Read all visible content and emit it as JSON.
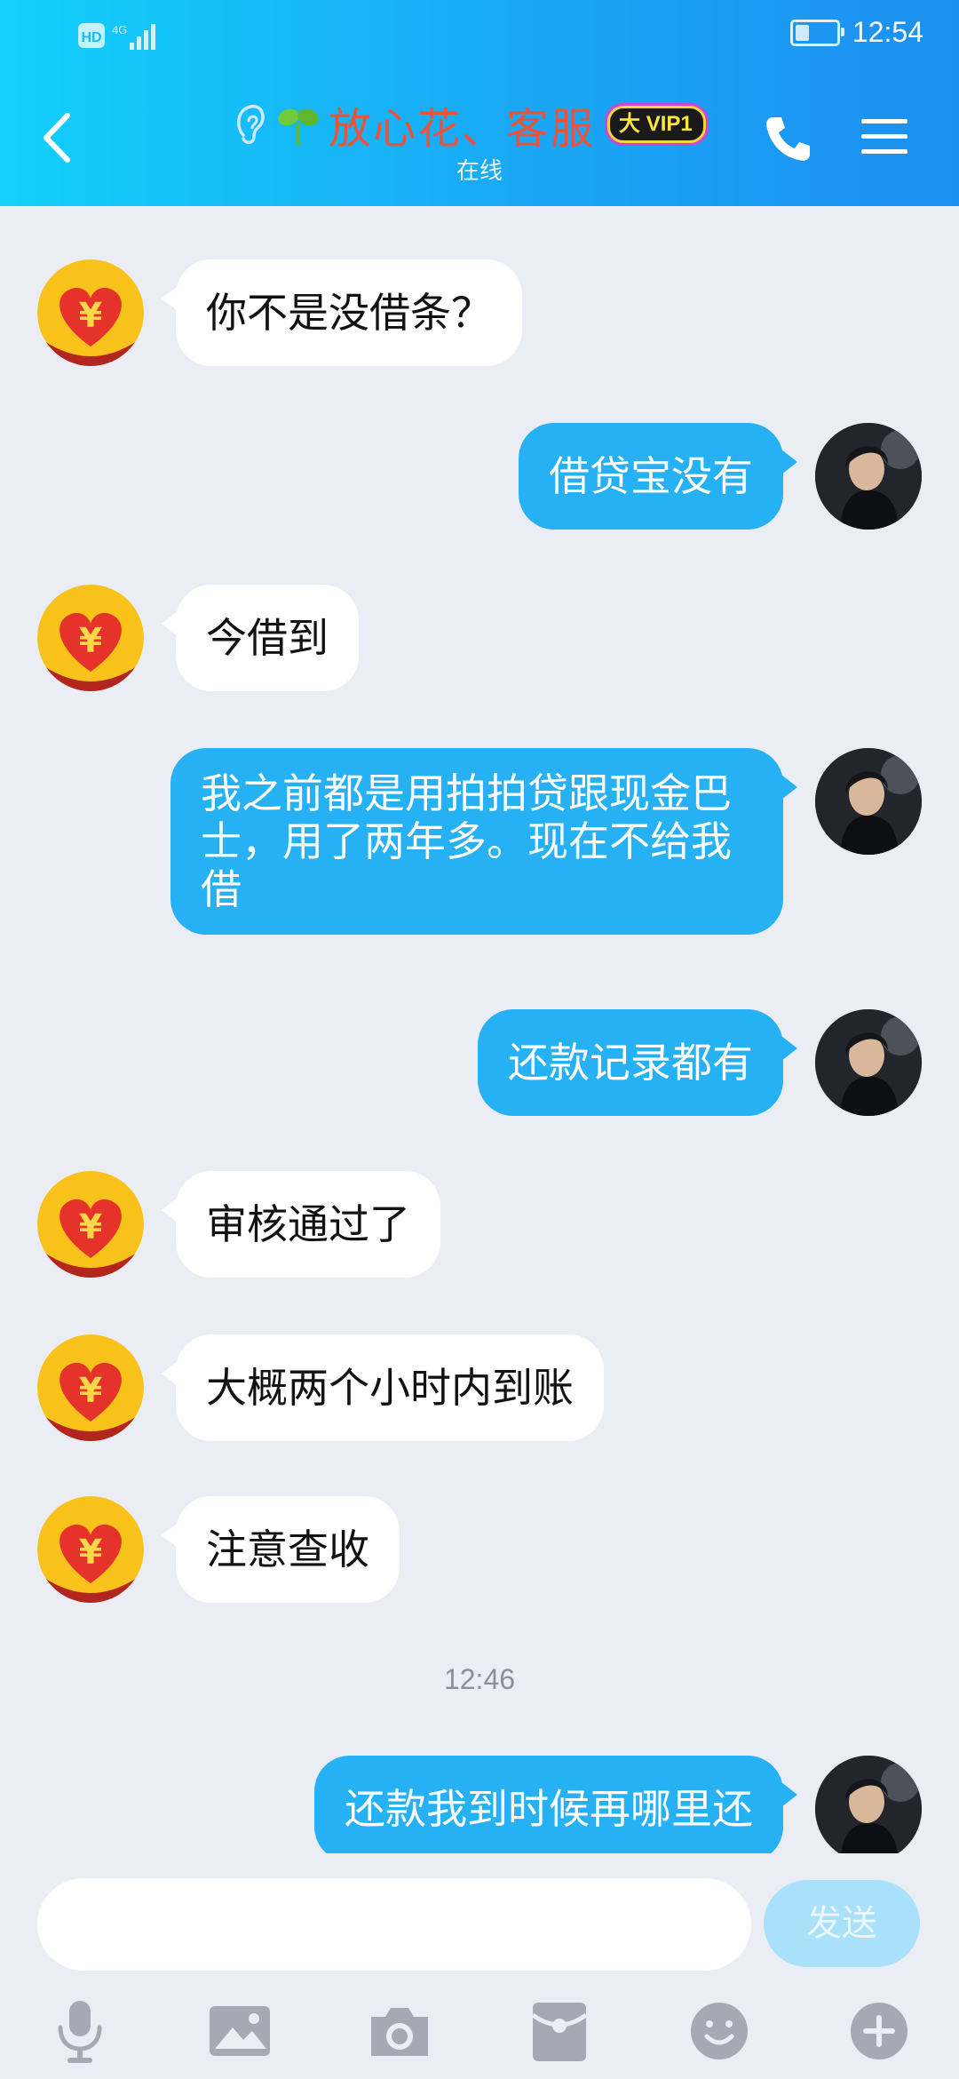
{
  "status_bar": {
    "network": "HD 4G",
    "time": "12:54",
    "battery_fraction": 0.35
  },
  "header": {
    "title": "放心花、客服",
    "vip": "VIP1",
    "presence": "在线"
  },
  "messages": [
    {
      "side": "in",
      "text": "你不是没借条？"
    },
    {
      "side": "out",
      "text": "借贷宝没有"
    },
    {
      "side": "in",
      "text": "今借到"
    },
    {
      "side": "out",
      "text": "我之前都是用拍拍贷跟现金巴士，用了两年多。现在不给我借"
    },
    {
      "side": "out",
      "text": "还款记录都有"
    },
    {
      "side": "in",
      "text": "审核通过了"
    },
    {
      "side": "in",
      "text": "大概两个小时内到账"
    },
    {
      "side": "in",
      "text": "注意查收"
    },
    {
      "side": "out",
      "text": "还款我到时候再哪里还"
    }
  ],
  "timestamp": "12:46",
  "composer": {
    "input_value": "",
    "send_label": "发送"
  },
  "toolbar": {
    "icons": [
      "microphone-icon",
      "image-icon",
      "camera-icon",
      "red-packet-icon",
      "emoji-icon",
      "plus-icon"
    ]
  },
  "colors": {
    "header_gradient": [
      "#12d0fb",
      "#1b8ff0"
    ],
    "outgoing_bubble": "#27b1f5",
    "incoming_bubble": "#ffffff",
    "title_text": "#e8533a",
    "background": "#ebedf5"
  }
}
